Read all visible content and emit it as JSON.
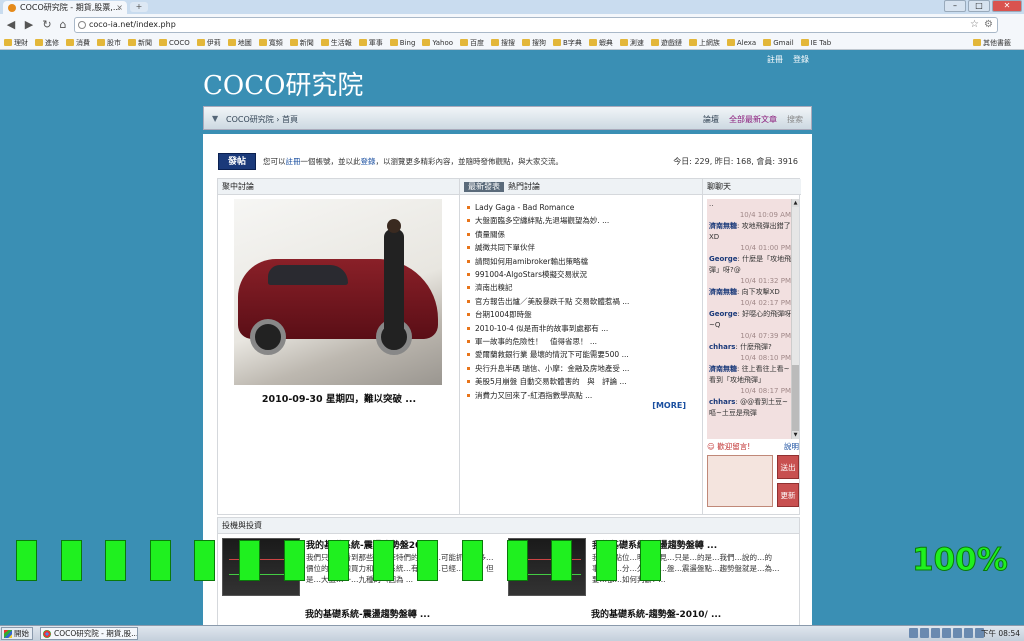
{
  "browser": {
    "tab_title": "COCO研究院 - 期貨,股票,...",
    "url": "coco-ia.net/index.php"
  },
  "bookmarks": [
    "理財",
    "進修",
    "消費",
    "股市",
    "新聞",
    "COCO",
    "伊莉",
    "地圖",
    "寬頻",
    "新聞",
    "生活報",
    "軍事",
    "Bing",
    "Yahoo",
    "百度",
    "搜搜",
    "搜狗",
    "B字典",
    "蝦典",
    "測速",
    "遊戲鏈",
    "上網族",
    "Alexa",
    "Gmail",
    "IE Tab",
    "其他書籤"
  ],
  "site": {
    "top_links": {
      "register": "註冊",
      "login": "登錄"
    },
    "title": "COCO研究院",
    "breadcrumb": "COCO研究院 › 首頁",
    "nav_links": {
      "rank": "論壇",
      "all_new": "全部最新文章",
      "search": "搜索"
    },
    "post_button": "發帖",
    "welcome_pre": "您可以",
    "welcome_register": "註冊",
    "welcome_mid": "一個帳號，並以此",
    "welcome_login": "登錄",
    "welcome_post": "，以瀏覽更多精彩內容，並隨時發佈觀點，與大家交流。",
    "stats": "今日: 229, 昨日: 168, 會員: 3916"
  },
  "sections": {
    "featured_header": "聚中討論",
    "featured_caption": "2010-09-30 星期四，難以突破 ...",
    "tab_new": "最新發表",
    "tab_hot": "熱門討論",
    "more": "[MORE]",
    "chat_header": "聊聊天",
    "chat_say": "歡迎留言!",
    "chat_help": "說明",
    "chat_send": "送出",
    "chat_refresh": "更新",
    "invest_header": "投機與投資"
  },
  "latest_posts": [
    "Lady Gaga - Bad Romance",
    "大盤面臨多空纏絆點,先退場觀望為妙. ...",
    "債量關係",
    "誠徵共同下單伙伴",
    "請問如何用amibroker輸出策略檔",
    "991004-AlgoStars模擬交易狀況",
    "濟南出糗記",
    "官方報告出爐／美股暴跌千點 交易軟體惹禍 ...",
    "台期1004即時盤",
    "2010-10-4 似是而非的故事到處都有 ...",
    "軍一故事的危險性！　值得省思！ ...",
    "愛爾蘭救銀行業 最壞的情況下可能需要500 ...",
    "央行升息半碼 瑞信、小摩：金融及房地產受 ...",
    "美股5月崩盤 自動交易軟體害的　與　評論 ...",
    "消費力又回來了-紅酒指數學高點 ..."
  ],
  "chat": [
    {
      "t": ".."
    },
    {
      "time": "10/4 10:09 AM"
    },
    {
      "name": "濟南無糖",
      "msg": "攻地飛彈出錯了XD"
    },
    {
      "time": "10/4 01:00 PM"
    },
    {
      "name": "George",
      "msg": "什麼是「攻地飛彈」呀?@"
    },
    {
      "time": "10/4 01:32 PM"
    },
    {
      "name": "濟南無糖",
      "msg": "向下攻擊XD"
    },
    {
      "time": "10/4 02:17 PM"
    },
    {
      "name": "George",
      "msg": "好噁心的飛彈呀~Q"
    },
    {
      "time": "10/4 07:39 PM"
    },
    {
      "name": "chhars",
      "msg": "什麼飛彈?"
    },
    {
      "time": "10/4 08:10 PM"
    },
    {
      "name": "濟南無糖",
      "msg": "往上看往上看~看到「攻地飛彈」"
    },
    {
      "time": "10/4 08:17 PM"
    },
    {
      "name": "chhars",
      "msg": "@@看到土豆~嘔~土豆是飛彈"
    }
  ],
  "articles": [
    {
      "title": "我的基礎系統-震盪趨勢盤20 ...",
      "text": "我們只是要看到那些被巴菲特們的參考…可能抓到很多…價位的…紅線買力和…的系統…有…時…已經…不跌，但是…大盤…一…九種的（因為 ..."
    },
    {
      "title": "我的基礎系統-震盪趨勢盤轉 ...",
      "text": "我們的點位…明確看見…只是…的是…我們…說的…的事…合…分…久…的…盤…震盪盤點…趨勢盤就是…為…要…都…如何判斷? ..."
    },
    {
      "title": "我的基礎系統-震盪趨勢盤轉 ..."
    },
    {
      "title": "我的基礎系統-趨勢盤-2010/ ..."
    }
  ],
  "progress": {
    "label": "100%",
    "bars": 15
  },
  "taskbar": {
    "start": "開始",
    "task": "COCO研究院 - 期貨,股...",
    "clock": "下午 08:54"
  }
}
